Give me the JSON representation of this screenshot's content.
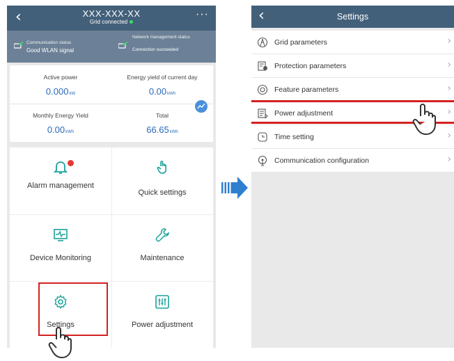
{
  "left_screen": {
    "title": "XXX-XXX-XX",
    "subtitle": "Grid connected",
    "status": {
      "comm_label": "Communication status",
      "comm_value": "Good WLAN signal",
      "nms_label": "Network management status",
      "nms_value": "Connection succeeded"
    },
    "energy": {
      "active_power_label": "Active power",
      "active_power_value": "0.000",
      "active_power_unit": "kW",
      "daily_label": "Energy yield of current day",
      "daily_value": "0.00",
      "daily_unit": "kWh",
      "monthly_label": "Monthly Energy Yield",
      "monthly_value": "0.00",
      "monthly_unit": "kWh",
      "total_label": "Total",
      "total_value": "66.65",
      "total_unit": "kWh"
    },
    "tiles": {
      "alarm": "Alarm management",
      "quick": "Quick settings",
      "monitoring": "Device Monitoring",
      "maintenance": "Maintenance",
      "settings": "Settings",
      "power": "Power adjustment"
    }
  },
  "right_screen": {
    "title": "Settings",
    "items": [
      {
        "label": "Grid parameters",
        "icon": "grid-parameters-icon"
      },
      {
        "label": "Protection parameters",
        "icon": "protection-icon"
      },
      {
        "label": "Feature parameters",
        "icon": "feature-icon"
      },
      {
        "label": "Power adjustment",
        "icon": "power-adjustment-icon"
      },
      {
        "label": "Time setting",
        "icon": "clock-icon"
      },
      {
        "label": "Communication configuration",
        "icon": "communication-icon"
      }
    ]
  },
  "colors": {
    "header": "#43607a",
    "status_bar": "#6c8197",
    "value_blue": "#2a6ab8",
    "highlight_red": "#d42020",
    "arrow_blue": "#2f7fd0"
  }
}
